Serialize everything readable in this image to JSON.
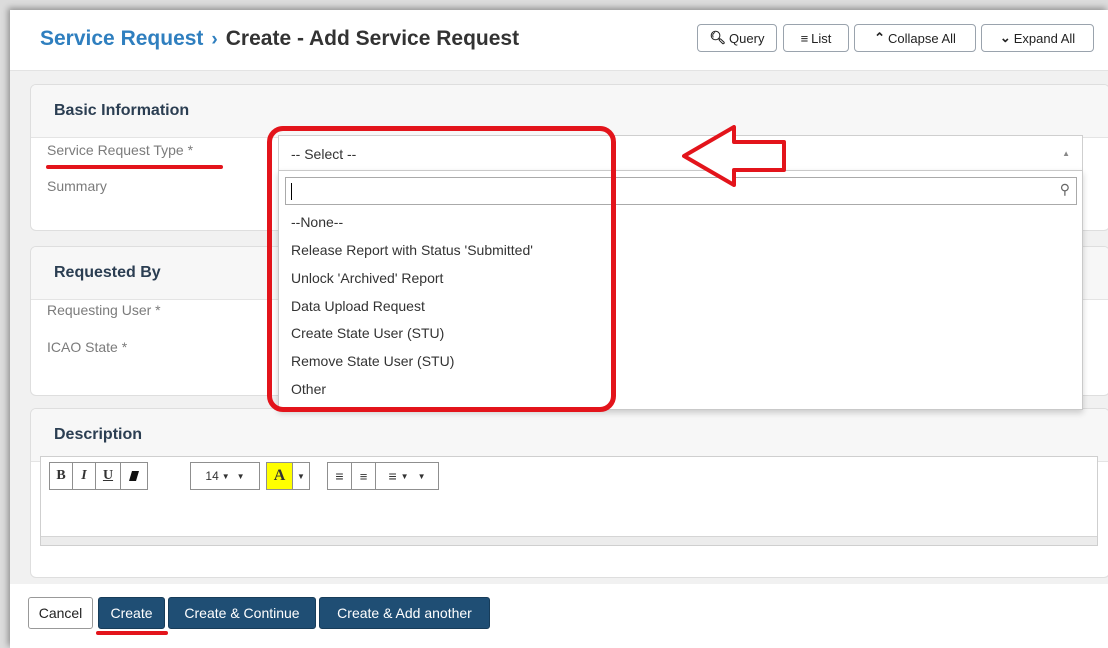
{
  "header": {
    "breadcrumb_parent": "Service Request",
    "breadcrumb_separator": "›",
    "page_title": "Create - Add Service Request",
    "buttons": {
      "query": "Query",
      "list": "List",
      "collapse_all": "Collapse All",
      "expand_all": "Expand All"
    }
  },
  "basic_information": {
    "title": "Basic Information",
    "service_request_type_label": "Service Request Type *",
    "summary_label": "Summary",
    "select": {
      "selected": "-- Select --",
      "search_value": "",
      "options": [
        "--None--",
        "Release Report with Status 'Submitted'",
        "Unlock 'Archived' Report",
        "Data Upload Request",
        "Create State User (STU)",
        "Remove State User (STU)",
        "Other"
      ]
    }
  },
  "requested_by": {
    "title": "Requested By",
    "requesting_user_label": "Requesting User *",
    "icao_state_label": "ICAO State *"
  },
  "description": {
    "title": "Description",
    "toolbar": {
      "bold": "B",
      "italic": "I",
      "underline": "U",
      "font_size": "14",
      "font_color": "A"
    }
  },
  "footer": {
    "cancel": "Cancel",
    "create": "Create",
    "create_continue": "Create & Continue",
    "create_add_another": "Create & Add another"
  },
  "annotation_colors": {
    "highlight": "#e3141b",
    "primary_button": "#1f4e74",
    "link": "#2f7fbf"
  }
}
